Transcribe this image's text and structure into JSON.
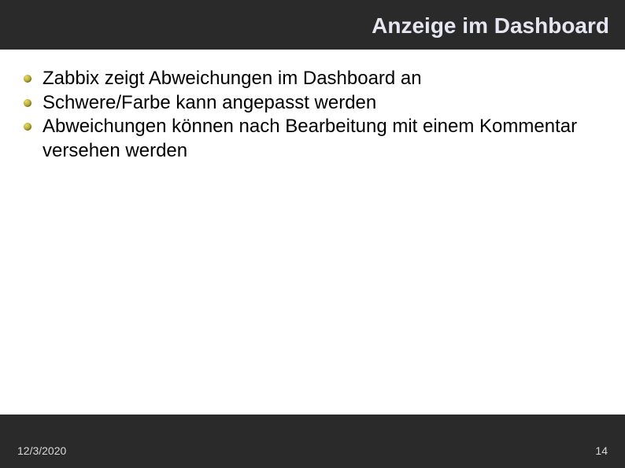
{
  "header": {
    "title": "Anzeige im Dashboard"
  },
  "content": {
    "bullets": [
      "Zabbix zeigt Abweichungen im Dashboard an",
      "Schwere/Farbe kann angepasst werden",
      "Abweichungen können nach Bearbeitung mit einem Kommentar versehen werden"
    ]
  },
  "footer": {
    "date": "12/3/2020",
    "page_number": "14"
  }
}
